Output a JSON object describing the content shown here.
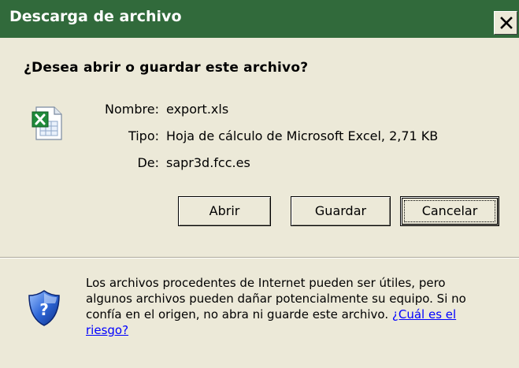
{
  "window": {
    "title": "Descarga de archivo",
    "close_label": "X"
  },
  "question": "¿Desea abrir o guardar este archivo?",
  "file": {
    "icon": "excel-spreadsheet-icon",
    "name_label": "Nombre:",
    "name": "export.xls",
    "type_label": "Tipo:",
    "type": "Hoja de cálculo de Microsoft Excel, 2,71 KB",
    "from_label": "De:",
    "from": "sapr3d.fcc.es"
  },
  "buttons": {
    "open": "Abrir",
    "save": "Guardar",
    "cancel": "Cancelar"
  },
  "warning": {
    "icon": "shield-question-icon",
    "text": "Los archivos procedentes de Internet pueden ser útiles, pero algunos archivos pueden dañar potencialmente su equipo. Si no confía en el origen, no abra ni guarde este archivo. ",
    "link": "¿Cuál es el riesgo?"
  },
  "colors": {
    "titlebar": "#316a3b",
    "dialog_bg": "#ece9d8",
    "link": "#0000ff"
  }
}
